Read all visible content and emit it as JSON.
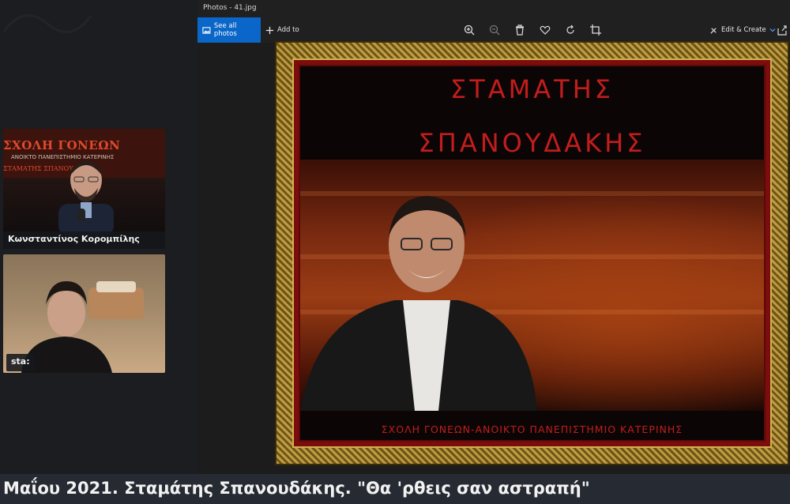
{
  "window": {
    "title": "Photos - 41.jpg"
  },
  "toolbar": {
    "see_all_photos": "See all photos",
    "add_to": "Add to",
    "edit_create": "Edit & Create"
  },
  "participants": [
    {
      "name": "Κωνσταντίνος Κορομπίλης",
      "background_banner": {
        "line1": "ΣΧΟΛΗ ΓΟΝΕΩΝ",
        "line2": "ΑΝΟΙΚΤΟ ΠΑΝΕΠΙΣΤΗΜΙΟ ΚΑΤΕΡΙΝΗΣ",
        "line3": "ΣΤΑΜΑΤΗΣ ΣΠΑΝΟΥΔΑΚΗΣ"
      }
    },
    {
      "name": "sta:"
    }
  ],
  "picture": {
    "title_line1": "ΣΤΑΜΑΤΗΣ",
    "title_line2": "ΣΠΑΝΟΥΔΑΚΗΣ",
    "caption": "ΣΧΟΛΗ ΓΟΝΕΩΝ-ΑΝΟΙΚΤΟ ΠΑΝΕΠΙΣΤΗΜΙΟ ΚΑΤΕΡΙΝΗΣ"
  },
  "ticker": {
    "text": "Μαΐου 2021. Σταμάτης Σπανουδάκης. \"Θα 'ρθεις σαν αστραπή\""
  },
  "colors": {
    "accent": "#0a66c8",
    "title_red": "#c21d1d",
    "frame_gold": "#8a6d22"
  }
}
